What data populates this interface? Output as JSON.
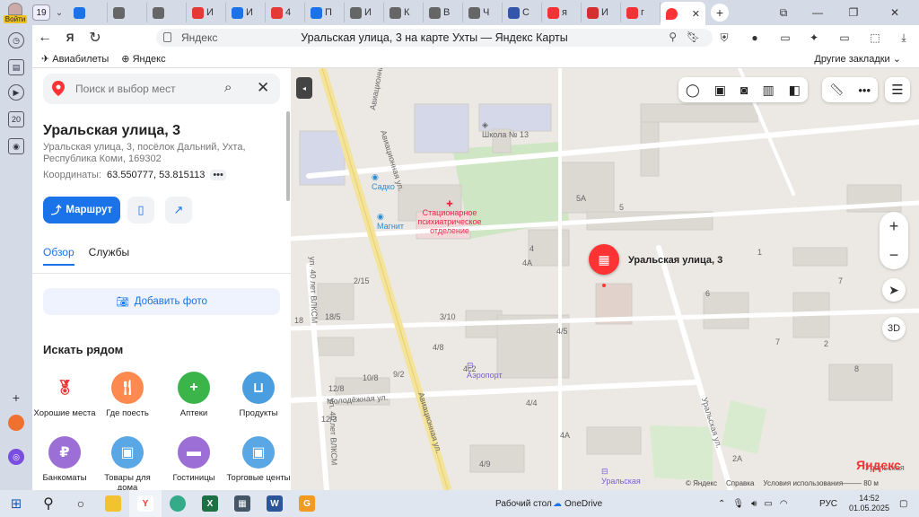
{
  "browser": {
    "login_label": "Войти",
    "tab_counter": "19",
    "tabs": [
      {
        "icon": "tab-icon-blue-square",
        "color": "#1a73e8",
        "label": ""
      },
      {
        "icon": "doc-icon",
        "color": "#666666",
        "label": ""
      },
      {
        "icon": "doc-icon",
        "color": "#666666",
        "label": ""
      },
      {
        "icon": "pdf-icon",
        "color": "#e53935",
        "label": "И"
      },
      {
        "icon": "blue-badge-icon",
        "color": "#1a73e8",
        "label": "И"
      },
      {
        "icon": "pdf-icon",
        "color": "#e53935",
        "label": "4"
      },
      {
        "icon": "blue-square-icon",
        "color": "#1a73e8",
        "label": "П"
      },
      {
        "icon": "doc-icon",
        "color": "#666666",
        "label": "И"
      },
      {
        "icon": "doc-icon",
        "color": "#666666",
        "label": "К"
      },
      {
        "icon": "doc-icon",
        "color": "#666666",
        "label": "В"
      },
      {
        "icon": "doc-icon",
        "color": "#666666",
        "label": "Ч"
      },
      {
        "icon": "shield-icon",
        "color": "#3355aa",
        "label": "С"
      },
      {
        "icon": "yandex-icon",
        "color": "#f33333",
        "label": "я"
      },
      {
        "icon": "ptc-icon",
        "color": "#d32f2f",
        "label": "И"
      },
      {
        "icon": "yandex-icon",
        "color": "#f33333",
        "label": "г"
      }
    ],
    "active_tab_icon": "map-pin-icon",
    "address_site": "Яндекс",
    "page_title": "Уральская улица, 3 на карте Ухты — Яндекс Карты",
    "bookmarks": [
      {
        "icon": "plane-icon",
        "label": "Авиабилеты"
      },
      {
        "icon": "yandex-plus-icon",
        "label": "Яндекс"
      }
    ],
    "other_bookmarks": "Другие закладки"
  },
  "place": {
    "search_placeholder": "Поиск и выбор мест",
    "title": "Уральская улица, 3",
    "address": "Уральская улица, 3, посёлок Дальний, Ухта, Республика Коми, 169302",
    "coords_label": "Координаты:",
    "coords_value": "63.550777, 53.815113",
    "route_label": "Маршрут",
    "tabs": [
      "Обзор",
      "Службы"
    ],
    "add_photo": "Добавить фото",
    "nearby_title": "Искать рядом",
    "categories": [
      {
        "label": "Хорошие места",
        "color": "#ffffff",
        "icon": "award-icon"
      },
      {
        "label": "Где поесть",
        "color": "#ff8a50",
        "icon": "fork-knife-icon"
      },
      {
        "label": "Аптеки",
        "color": "#3bb54a",
        "icon": "plus-icon"
      },
      {
        "label": "Продукты",
        "color": "#4a9ee0",
        "icon": "basket-icon"
      },
      {
        "label": "Банкоматы",
        "color": "#9b6fd6",
        "icon": "ruble-icon"
      },
      {
        "label": "Товары для дома",
        "color": "#5aa7e6",
        "icon": "bag-icon"
      },
      {
        "label": "Гостиницы",
        "color": "#9b6fd6",
        "icon": "bed-icon"
      },
      {
        "label": "Торговые центы",
        "color": "#5aa7e6",
        "icon": "bag-icon"
      }
    ]
  },
  "map": {
    "marker_label": "Уральская улица, 3",
    "streets": {
      "aviation1": "Авиационная ул.",
      "aviation2": "Авиационная ул.",
      "aviation_top": "Авиационная",
      "vlksm1": "ул. 40 лет ВЛКСМ",
      "vlksm2": "ул. 40 лет ВЛКСМ",
      "youth": "Молодёжная ул.",
      "ural": "Уральская ул.",
      "ural_top": "Уральская"
    },
    "pois": {
      "school": "Школа № 13",
      "sadko": "Садко",
      "magnit": "Магнит",
      "hospital": "Стационарное психиатрическое отделение",
      "airport": "Аэропорт",
      "ural_bottom": "Уральская"
    },
    "house_numbers": [
      "5А",
      "5",
      "4",
      "4А",
      "2/15",
      "3/10",
      "4/8",
      "4/5",
      "4с2",
      "4/4",
      "4А",
      "2А",
      "12/8",
      "12/3",
      "18/5",
      "18",
      "10/8",
      "9/2",
      "4/9",
      "7",
      "6",
      "1",
      "2",
      "8",
      "7"
    ],
    "logo": "Яндекс",
    "copyright": [
      "© Яндекс",
      "Справка",
      "Условия использования"
    ],
    "scale": "80 м",
    "btn_3d": "3D"
  },
  "taskbar": {
    "desktop_label": "Рабочий стол",
    "onedrive": "OneDrive",
    "lang": "РУС",
    "time": "14:52",
    "date": "01.05.2025"
  }
}
